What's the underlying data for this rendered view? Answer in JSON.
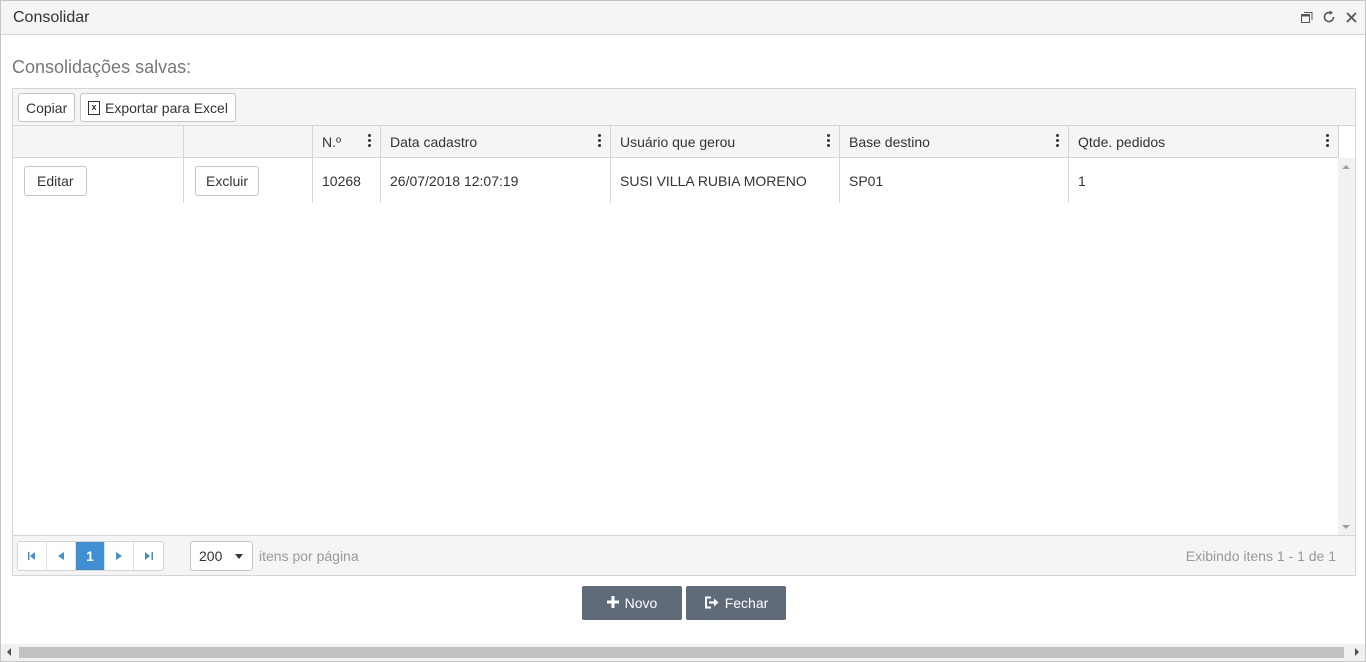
{
  "window": {
    "title": "Consolidar"
  },
  "section_label": "Consolidações salvas:",
  "toolbar": {
    "copy_label": "Copiar",
    "excel_label": "Exportar para Excel"
  },
  "table": {
    "headers": [
      "",
      "",
      "N.º",
      "Data cadastro",
      "Usuário que gerou",
      "Base destino",
      "Qtde. pedidos"
    ],
    "rows": [
      {
        "edit_label": "Editar",
        "delete_label": "Excluir",
        "numero": "10268",
        "data_cadastro": "26/07/2018 12:07:19",
        "usuario": "SUSI VILLA RUBIA MORENO",
        "base_destino": "SP01",
        "qtde_pedidos": "1"
      }
    ]
  },
  "pager": {
    "current_page": "1",
    "page_size": "200",
    "page_size_label": "itens por página",
    "info": "Exibindo itens 1 - 1 de 1",
    "icons": {
      "first": "first-page-icon",
      "prev": "prev-page-icon",
      "next": "next-page-icon",
      "last": "last-page-icon"
    }
  },
  "actions": {
    "new_label": "Novo",
    "close_label": "Fechar"
  },
  "colors": {
    "accent": "#3f8fd2",
    "action_button": "#5f6b78"
  }
}
